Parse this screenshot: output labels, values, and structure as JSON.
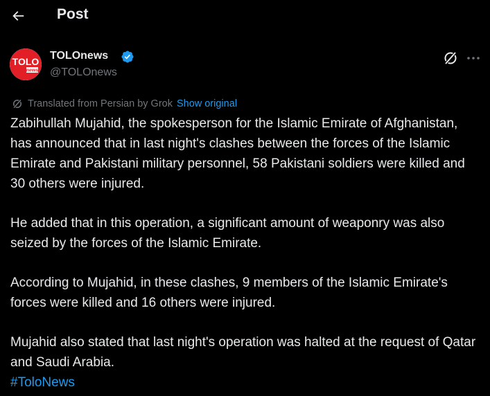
{
  "header": {
    "title": "Post",
    "back_icon": "arrow-left-icon"
  },
  "author": {
    "name": "TOLOnews",
    "handle": "@TOLOnews",
    "verified": true,
    "avatar_text_top": "TOLO",
    "avatar_text_bottom": "news",
    "avatar_color": "#e21f26"
  },
  "translation": {
    "label": "Translated from Persian by Grok",
    "show_original": "Show original"
  },
  "post": {
    "paragraphs": [
      "Zabihullah Mujahid, the spokesperson for the Islamic Emirate of Afghanistan, has announced that in last night's clashes between the forces of the Islamic Emirate and Pakistani military personnel, 58 Pakistani soldiers were killed and 30 others were injured.",
      "He added that in this operation, a significant amount of weaponry was also seized by the forces of the Islamic Emirate.",
      "According to Mujahid, in these clashes, 9 members of the Islamic Emirate's forces were killed and 16 others were injured.",
      "Mujahid also stated that last night's operation was halted at the request of Qatar and Saudi Arabia."
    ],
    "hashtag": "#ToloNews"
  },
  "colors": {
    "background": "#000000",
    "text": "#e7e9ea",
    "muted": "#71767b",
    "accent": "#1d9bf0"
  }
}
